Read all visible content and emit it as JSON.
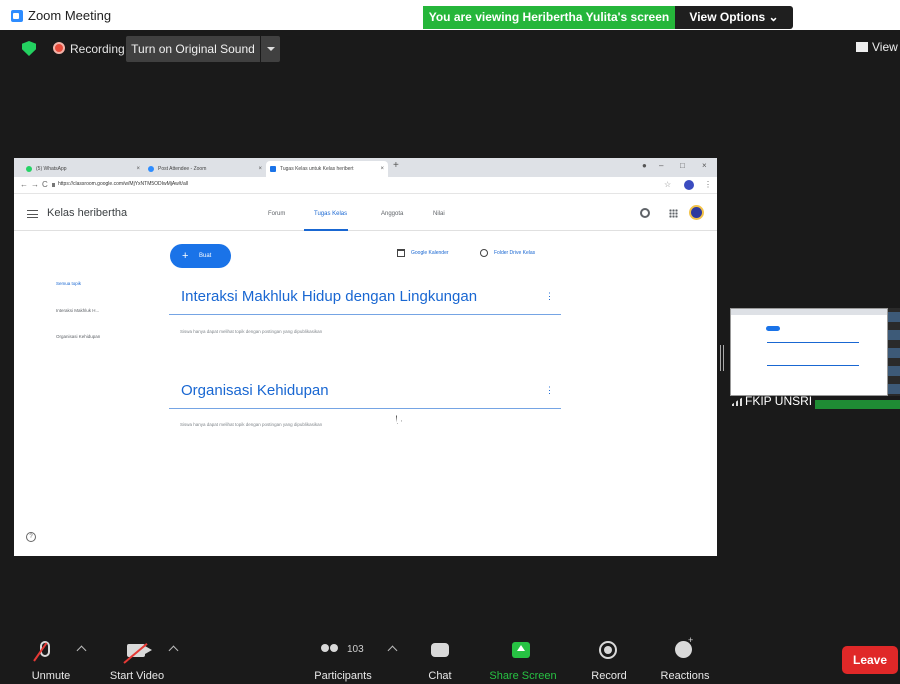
{
  "window": {
    "title": "Zoom Meeting"
  },
  "banner": {
    "viewing": "You are viewing Heribertha Yulita's screen",
    "view_options": "View Options ⌄"
  },
  "status": {
    "recording": "Recording",
    "original_sound": "Turn on Original Sound",
    "view": "View"
  },
  "browser": {
    "tabs": [
      {
        "label": "(5) WhatsApp",
        "color": "#25d366"
      },
      {
        "label": "Post Attendee - Zoom",
        "color": "#2d8cff"
      },
      {
        "label": "Tugas Kelas untuk Kelas heribert",
        "color": "#1a73e8"
      }
    ],
    "url": "https://classroom.google.com/w/MjYxNTM5ODIwMjAw/t/all"
  },
  "classroom": {
    "class_name": "Kelas heribertha",
    "nav": [
      "Forum",
      "Tugas Kelas",
      "Anggota",
      "Nilai"
    ],
    "create_label": "Buat",
    "calendar_label": "Google Kalender",
    "drive_label": "Folder Drive Kelas",
    "side_topics": [
      "Semua topik",
      "Interaksi Makhluk H...",
      "Organisasi Kehidupan"
    ],
    "topics": [
      {
        "title": "Interaksi Makhluk Hidup dengan Lingkungan",
        "note": "Siswa hanya dapat melihat topik dengan postingan yang dipublikasikan"
      },
      {
        "title": "Organisasi Kehidupan",
        "note": "Siswa hanya dapat melihat topik dengan postingan yang dipublikasikan"
      }
    ]
  },
  "thumbnail": {
    "name": "FKIP UNSRI"
  },
  "toolbar": {
    "unmute": "Unmute",
    "start_video": "Start Video",
    "participants": "Participants",
    "participant_count": "103",
    "chat": "Chat",
    "share_screen": "Share Screen",
    "record": "Record",
    "reactions": "Reactions",
    "leave": "Leave"
  },
  "colors": {
    "zoom_blue": "#2d8cff",
    "share_green": "#27c243",
    "leave_red": "#e02828",
    "classroom_blue": "#1967d2"
  }
}
